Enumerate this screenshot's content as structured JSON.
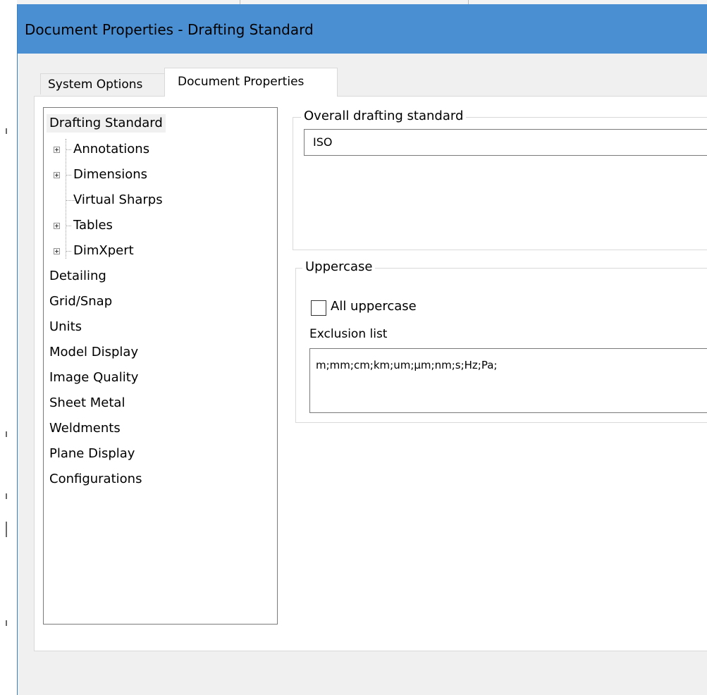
{
  "window": {
    "title": "Document Properties - Drafting Standard"
  },
  "tabs": [
    {
      "label": "System Options",
      "active": false
    },
    {
      "label": "Document Properties",
      "active": true
    }
  ],
  "tree": {
    "items": [
      {
        "label": "Drafting Standard",
        "level": 0,
        "selected": true,
        "expandable": false
      },
      {
        "label": "Annotations",
        "level": 1,
        "expandable": true
      },
      {
        "label": "Dimensions",
        "level": 1,
        "expandable": true
      },
      {
        "label": "Virtual Sharps",
        "level": 1,
        "expandable": false
      },
      {
        "label": "Tables",
        "level": 1,
        "expandable": true
      },
      {
        "label": "DimXpert",
        "level": 1,
        "expandable": true
      },
      {
        "label": "Detailing",
        "level": 0
      },
      {
        "label": "Grid/Snap",
        "level": 0
      },
      {
        "label": "Units",
        "level": 0
      },
      {
        "label": "Model Display",
        "level": 0
      },
      {
        "label": "Image Quality",
        "level": 0
      },
      {
        "label": "Sheet Metal",
        "level": 0
      },
      {
        "label": "Weldments",
        "level": 0
      },
      {
        "label": "Plane Display",
        "level": 0
      },
      {
        "label": "Configurations",
        "level": 0
      }
    ]
  },
  "overall": {
    "label": "Overall drafting standard",
    "value": "ISO"
  },
  "uppercase": {
    "label": "Uppercase",
    "checkbox_label": "All uppercase",
    "checked": false,
    "exclusion_label": "Exclusion list",
    "exclusion_value": "m;mm;cm;km;um;µm;nm;s;Hz;Pa;"
  },
  "colors": {
    "titlebar": "#4a8fd2",
    "dialog_bg": "#f0f0f0",
    "panel_bg": "#ffffff"
  }
}
